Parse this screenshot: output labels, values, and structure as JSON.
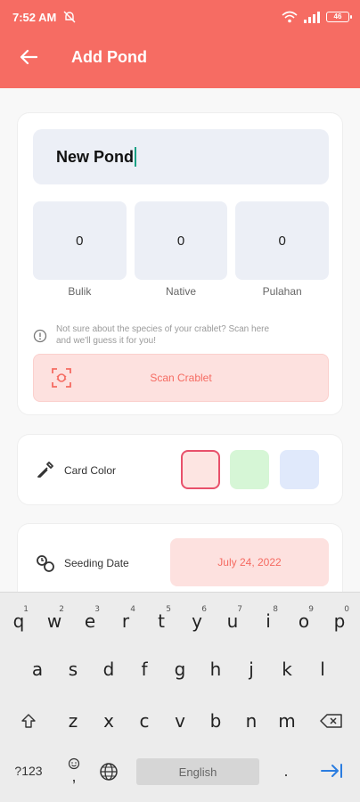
{
  "status_bar": {
    "time": "7:52 AM",
    "battery": "46"
  },
  "app_bar": {
    "title": "Add Pond"
  },
  "pond_name": {
    "value": "New Pond"
  },
  "species_counts": [
    {
      "label": "Bulik",
      "value": "0"
    },
    {
      "label": "Native",
      "value": "0"
    },
    {
      "label": "Pulahan",
      "value": "0"
    }
  ],
  "scan_hint": {
    "line1": "Not sure about the species of your crablet? Scan here",
    "line2": "and we'll guess it for you!"
  },
  "scan_button": {
    "label": "Scan Crablet"
  },
  "card_color": {
    "label": "Card Color",
    "swatches": [
      "#fde5e2",
      "#d6f6d6",
      "#e0e9fb"
    ],
    "selected_index": 0
  },
  "seeding_date": {
    "label": "Seeding Date",
    "value": "July 24, 2022"
  },
  "keyboard": {
    "row1": [
      "q",
      "w",
      "e",
      "r",
      "t",
      "y",
      "u",
      "i",
      "o",
      "p"
    ],
    "row1_numbers": [
      "1",
      "2",
      "3",
      "4",
      "5",
      "6",
      "7",
      "8",
      "9",
      "0"
    ],
    "row2": [
      "a",
      "s",
      "d",
      "f",
      "g",
      "h",
      "j",
      "k",
      "l"
    ],
    "row3": [
      "z",
      "x",
      "c",
      "v",
      "b",
      "n",
      "m"
    ],
    "symbols_key": "?123",
    "comma_key": ",",
    "space_label": "English",
    "period_key": "."
  },
  "colors": {
    "brand": "#f66c63",
    "accent": "#f56b62"
  }
}
